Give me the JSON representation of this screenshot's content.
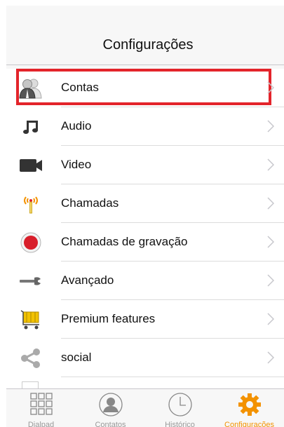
{
  "navbar": {
    "title": "Configurações"
  },
  "settings": {
    "items": [
      {
        "label": "Contas",
        "icon": "user-accounts-icon",
        "highlighted": true
      },
      {
        "label": "Audio",
        "icon": "music-note-icon"
      },
      {
        "label": "Video",
        "icon": "video-camera-icon"
      },
      {
        "label": "Chamadas",
        "icon": "antenna-icon"
      },
      {
        "label": "Chamadas de gravação",
        "icon": "record-icon"
      },
      {
        "label": "Avançado",
        "icon": "wrench-icon"
      },
      {
        "label": "Premium features",
        "icon": "shopping-cart-icon"
      },
      {
        "label": "social",
        "icon": "share-icon"
      }
    ]
  },
  "tabbar": {
    "tabs": [
      {
        "label": "Dialpad",
        "icon": "dialpad-icon"
      },
      {
        "label": "Contatos",
        "icon": "contacts-icon"
      },
      {
        "label": "Histórico",
        "icon": "clock-icon"
      },
      {
        "label": "Configurações",
        "icon": "gear-icon",
        "active": true
      }
    ]
  },
  "colors": {
    "accent": "#f39200",
    "highlight": "#e3242b"
  }
}
